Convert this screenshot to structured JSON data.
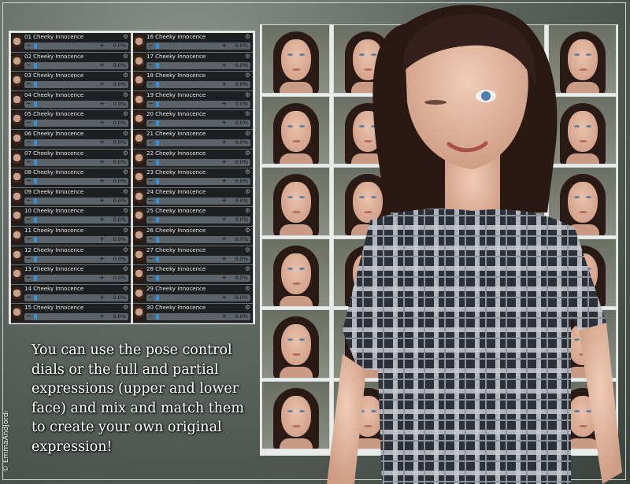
{
  "sliders": [
    {
      "label": "01 Cheeky Innocence",
      "value": "0.0%"
    },
    {
      "label": "02 Cheeky Innocence",
      "value": "0.0%"
    },
    {
      "label": "03 Cheeky Innocence",
      "value": "0.0%"
    },
    {
      "label": "04 Cheeky Innocence",
      "value": "0.0%"
    },
    {
      "label": "05 Cheeky Innocence",
      "value": "0.0%"
    },
    {
      "label": "06 Cheeky Innocence",
      "value": "0.0%"
    },
    {
      "label": "07 Cheeky Innocence",
      "value": "0.0%"
    },
    {
      "label": "08 Cheeky Innocence",
      "value": "0.0%"
    },
    {
      "label": "09 Cheeky Innocence",
      "value": "0.0%"
    },
    {
      "label": "10 Cheeky Innocence",
      "value": "0.0%"
    },
    {
      "label": "11 Cheeky Innocence",
      "value": "0.0%"
    },
    {
      "label": "12 Cheeky Innocence",
      "value": "0.0%"
    },
    {
      "label": "13 Cheeky Innocence",
      "value": "0.0%"
    },
    {
      "label": "14 Cheeky Innocence",
      "value": "0.0%"
    },
    {
      "label": "15 Cheeky Innocence",
      "value": "0.0%"
    },
    {
      "label": "16 Cheeky Innocence",
      "value": "0.0%"
    },
    {
      "label": "17 Cheeky Innocence",
      "value": "0.0%"
    },
    {
      "label": "18 Cheeky Innocence",
      "value": "0.0%"
    },
    {
      "label": "19 Cheeky Innocence",
      "value": "0.0%"
    },
    {
      "label": "20 Cheeky Innocence",
      "value": "0.0%"
    },
    {
      "label": "21 Cheeky Innocence",
      "value": "0.0%"
    },
    {
      "label": "22 Cheeky Innocence",
      "value": "0.0%"
    },
    {
      "label": "23 Cheeky Innocence",
      "value": "0.0%"
    },
    {
      "label": "24 Cheeky Innocence",
      "value": "0.0%"
    },
    {
      "label": "25 Cheeky Innocence",
      "value": "0.0%"
    },
    {
      "label": "26 Cheeky Innocence",
      "value": "0.0%"
    },
    {
      "label": "27 Cheeky Innocence",
      "value": "0.0%"
    },
    {
      "label": "28 Cheeky Innocence",
      "value": "0.0%"
    },
    {
      "label": "29 Cheeky Innocence",
      "value": "0.0%"
    },
    {
      "label": "30 Cheeky Innocence",
      "value": "0.0%"
    }
  ],
  "caption": "You can use the pose control dials or the full and partial expressions (upper and lower face) and mix and match them to create your own original expression!",
  "watermark": "© EmmaAndJordi",
  "colors": {
    "slider_handle": "#3b8ed8",
    "slider_bg": "#1e1f21",
    "panel_border": "#ffffff"
  },
  "icons": {
    "slider_settings": "gear-icon",
    "decrease": "minus-icon",
    "increase": "plus-icon"
  }
}
